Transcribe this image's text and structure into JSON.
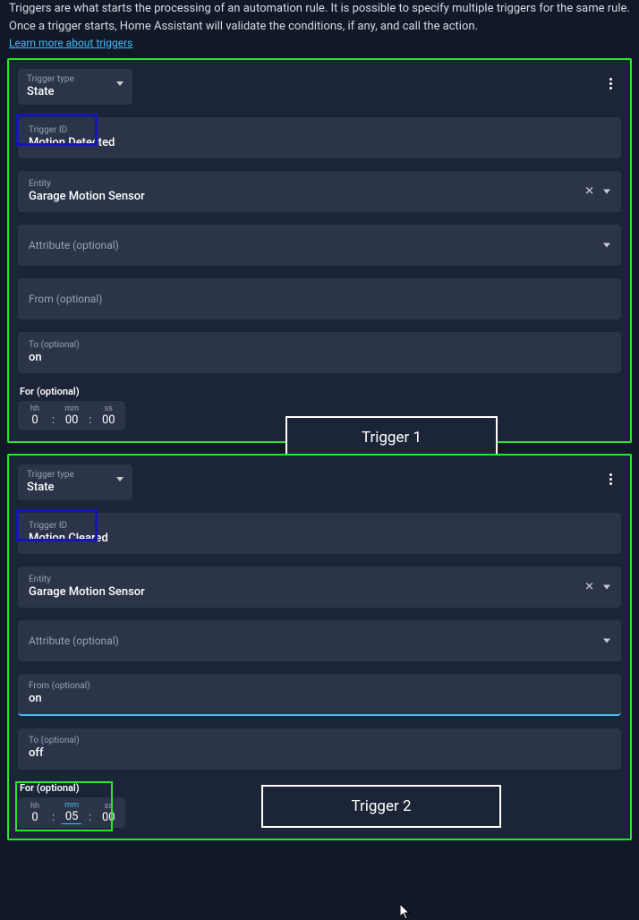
{
  "intro": "Triggers are what starts the processing of an automation rule. It is possible to specify multiple triggers for the same rule. Once a trigger starts, Home Assistant will validate the conditions, if any, and call the action.",
  "learn_more": "Learn more about triggers",
  "labels": {
    "trigger_type": "Trigger type",
    "trigger_id": "Trigger ID",
    "entity": "Entity",
    "attribute": "Attribute (optional)",
    "from": "From (optional)",
    "to": "To (optional)",
    "for": "For (optional)",
    "hh": "hh",
    "mm": "mm",
    "ss": "ss"
  },
  "triggers": [
    {
      "type": "State",
      "trigger_id": "Motion Detected",
      "entity": "Garage Motion Sensor",
      "attribute": "",
      "from": "",
      "to": "on",
      "for": {
        "hh": "0",
        "mm": "00",
        "ss": "00"
      }
    },
    {
      "type": "State",
      "trigger_id": "Motion Cleared",
      "entity": "Garage Motion Sensor",
      "attribute": "",
      "from": "on",
      "to": "off",
      "for": {
        "hh": "0",
        "mm": "05",
        "ss": "00"
      }
    }
  ],
  "annotations": {
    "trigger1": "Trigger 1",
    "trigger2": "Trigger 2"
  }
}
